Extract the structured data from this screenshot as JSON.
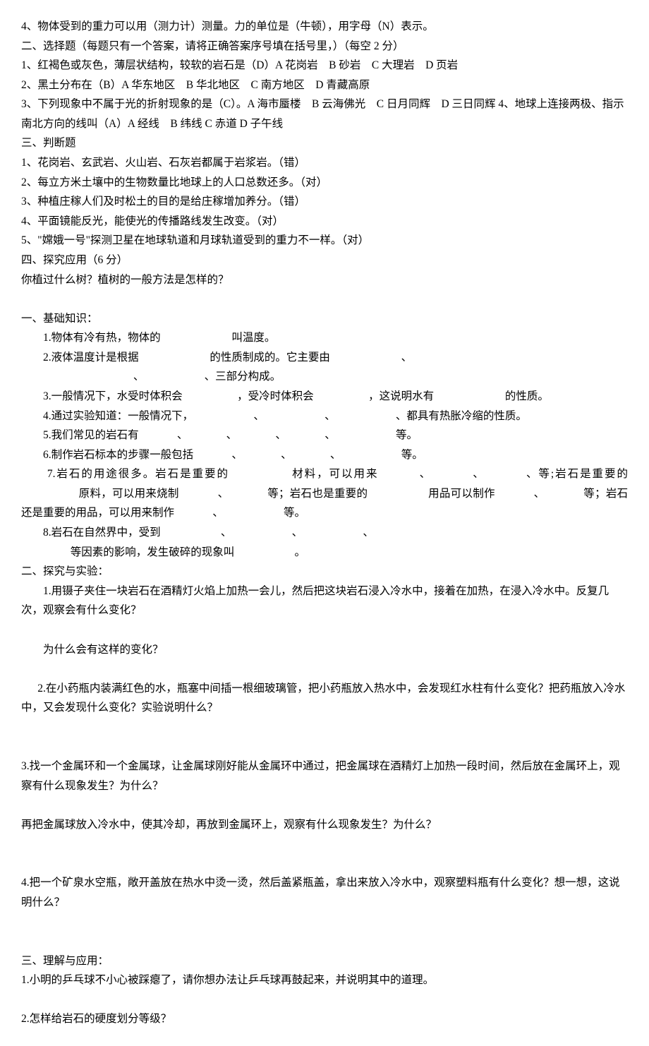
{
  "top": {
    "q4": "4、物体受到的重力可以用（测力计）测量。力的单位是（牛顿），用字母（N）表示。",
    "section2_title": "二、选择题（每题只有一个答案，请将正确答案序号填在括号里，）（每空 2 分）",
    "s2_q1": "1、红褐色或灰色，薄层状结构，较软的岩石是（D）A 花岗岩　B 砂岩　C 大理岩　D 页岩",
    "s2_q2": "2、黑土分布在（B）A 华东地区　B 华北地区　C 南方地区　D 青藏高原",
    "s2_q3": "3、下列现象中不属于光的折射现象的是（C）。A 海市蜃楼　B 云海佛光　C 日月同辉　D 三日同辉 4、地球上连接两极、指示南北方向的线叫（A）A 经线　B 纬线 C 赤道 D 子午线",
    "section3_title": "三、判断题",
    "s3_q1": "1、花岗岩、玄武岩、火山岩、石灰岩都属于岩浆岩。（错）",
    "s3_q2": "2、每立方米土壤中的生物数量比地球上的人口总数还多。（对）",
    "s3_q3": "3、种植庄稼人们及时松土的目的是给庄稼增加养分。（错）",
    "s3_q4": "4、平面镜能反光，能使光的传播路线发生改变。（对）",
    "s3_q5": "5、\"嫦娥一号\"探测卫星在地球轨道和月球轨道受到的重力不一样。（对）",
    "section4_title": "四、探究应用（6 分）",
    "s4_q": "你植过什么树？植树的一般方法是怎样的？"
  },
  "mid": {
    "section1_title": "一、基础知识：",
    "b1_a": "1.物体有冷有热，物体的",
    "b1_b": "叫温度。",
    "b2_a": "2.液体温度计是根据",
    "b2_b": "的性质制成的。它主要由",
    "b2_c": "、",
    "b2_d": "、三部分构成。",
    "b3_a": "3.一般情况下，水受时体积会",
    "b3_b": "，受冷时体积会",
    "b3_c": "，这说明水有",
    "b3_d": "的性质。",
    "b4_a": "4.通过实验知道：一般情况下，",
    "b4_cm": "、",
    "b4_b": "、都具有热胀冷缩的性质。",
    "b5_a": "5.我们常见的岩石有",
    "b5_b": "等。",
    "b6_a": "6.制作岩石标本的步骤一般包括",
    "b6_b": "等。",
    "b7_a": "7.岩石的用途很多。岩石是重要的",
    "b7_b": "材料，可以用来",
    "b7_c": "、等;岩石是重要的",
    "b7_d": "原料，可以用来烧制",
    "b7_e": "等；岩石也是重要的",
    "b7_f": "用品可以制作",
    "b7_g": "等；岩石还是重要的用品，可以用来制作",
    "b7_h": "等。",
    "b8_a": "8.岩石在自然界中，受到",
    "b8_b": "等因素的影响，发生破碎的现象叫",
    "b8_c": "。",
    "section2_title": "二、探究与实验：",
    "e1": "1.用镊子夹住一块岩石在酒精灯火焰上加热一会儿，然后把这块岩石浸入冷水中，接着在加热，在浸入冷水中。反复几次，观察会有什么变化？",
    "e1_sub": "为什么会有这样的变化？",
    "e2": "2.在小药瓶内装满红色的水，瓶塞中间插一根细玻璃管，把小药瓶放入热水中，会发现红水柱有什么变化？把药瓶放入冷水中，又会发现什么变化？实验说明什么？",
    "e3": "3.找一个金属环和一个金属球，让金属球刚好能从金属环中通过，把金属球在酒精灯上加热一段时间，然后放在金属环上，观察有什么现象发生？为什么？",
    "e3_sub": "再把金属球放入冷水中，使其冷却，再放到金属环上，观察有什么现象发生？为什么？",
    "e4": "4.把一个矿泉水空瓶，敞开盖放在热水中烫一烫，然后盖紧瓶盖，拿出来放入冷水中，观察塑料瓶有什么变化？想一想，这说明什么？",
    "section3_title": "三、理解与应用：",
    "u1": "1.小明的乒乓球不小心被踩瘪了，请你想办法让乒乓球再鼓起来，并说明其中的道理。",
    "u2": "2.怎样给岩石的硬度划分等级？"
  }
}
